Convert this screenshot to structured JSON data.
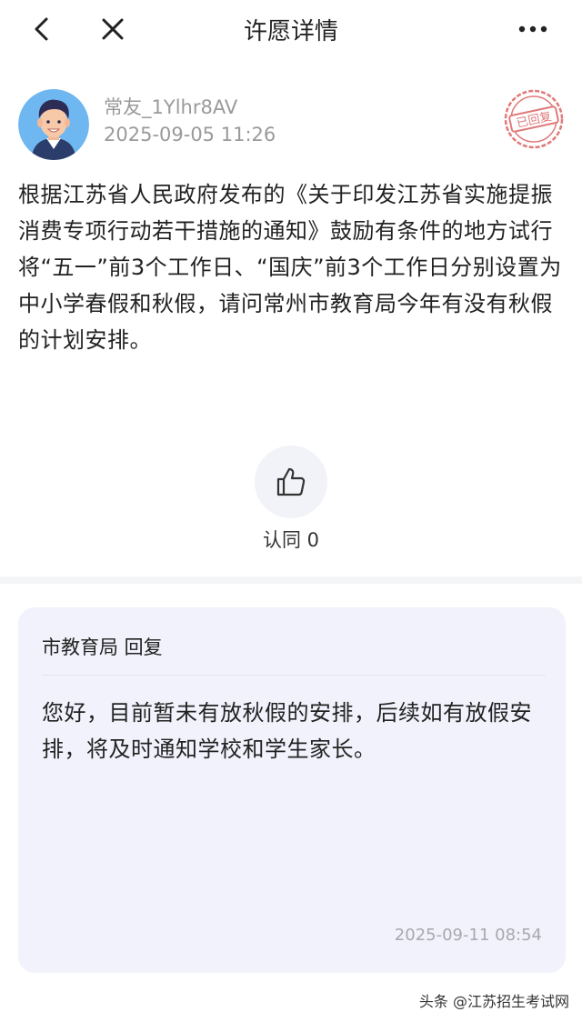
{
  "nav": {
    "title": "许愿详情"
  },
  "post": {
    "user_name": "常友_1Ylhr8AV",
    "time": "2025-09-05 11:26",
    "stamp_text": "已回复",
    "question": "根据江苏省人民政府发布的《关于印发江苏省实施提振消费专项行动若干措施的通知》鼓励有条件的地方试行将“五一”前3个工作日、“国庆”前3个工作日分别设置为中小学春假和秋假，请问常州市教育局今年有没有秋假的计划安排。"
  },
  "like": {
    "label": "认同 0"
  },
  "reply": {
    "header": "市教育局 回复",
    "body": "您好，目前暂未有放秋假的安排，后续如有放假安排，将及时通知学校和学生家长。",
    "time": "2025-09-11 08:54"
  },
  "watermark": "头条 @江苏招生考试网",
  "icons": {
    "back": "chevron-left-icon",
    "close": "close-icon",
    "more": "more-horizontal-icon",
    "like": "thumbs-up-icon",
    "stamp": "replied-stamp-icon"
  },
  "colors": {
    "stamp": "#e07a7a",
    "avatar_bg": "#6fb7f0",
    "reply_card_bg": "#f1f2fb",
    "like_bg": "#f2f3f8"
  }
}
